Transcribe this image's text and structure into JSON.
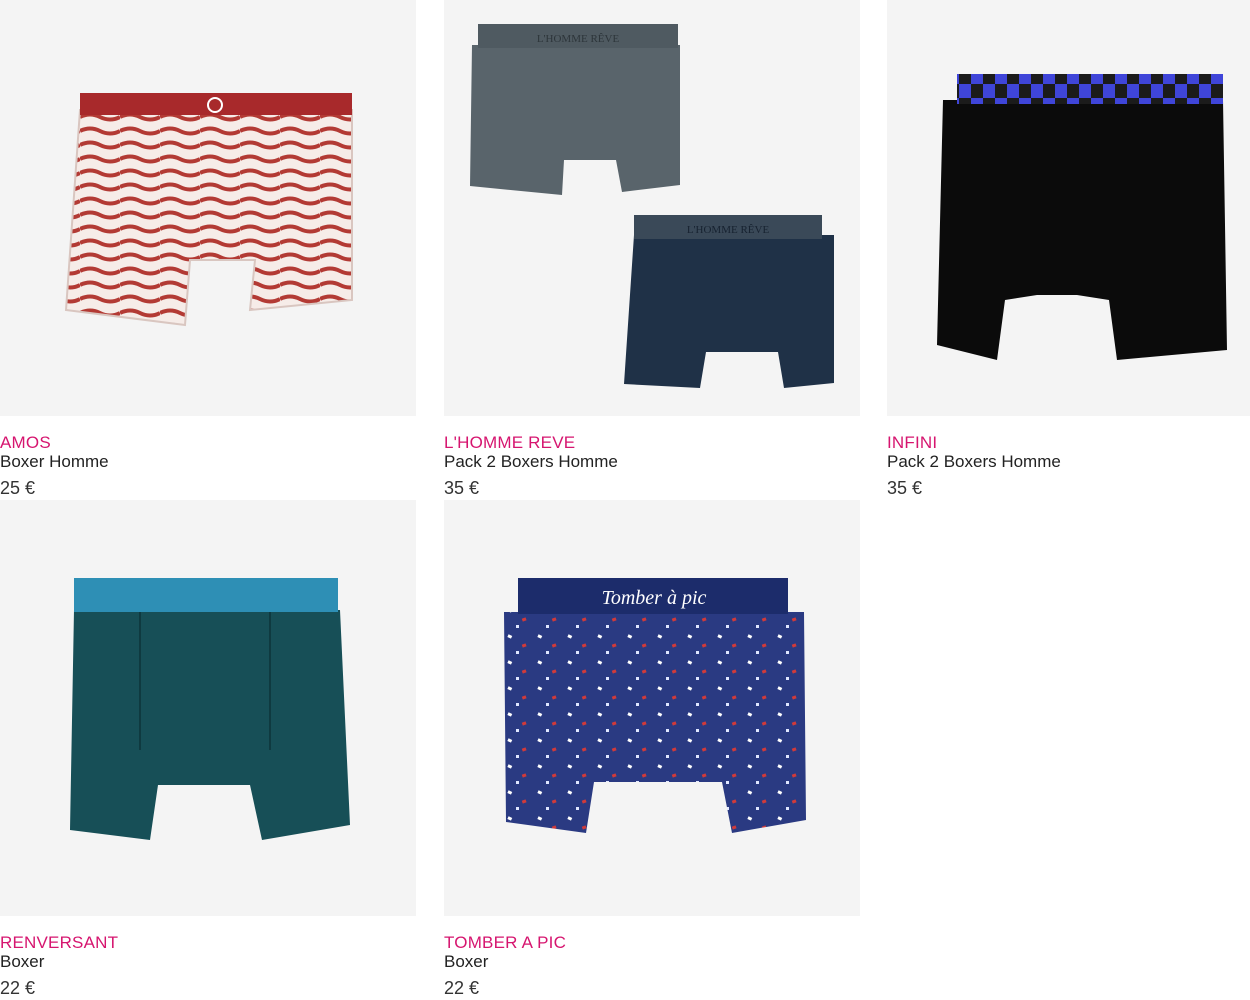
{
  "products": [
    {
      "brand": "AMOS",
      "name": "Boxer Homme",
      "price": "25 €",
      "image": "red-white-wave-boxer"
    },
    {
      "brand": "L'HOMME REVE",
      "name": "Pack 2 Boxers Homme",
      "price": "35 €",
      "image": "grey-navy-boxer-pack",
      "waistband_text": "L'HOMME RÊVE"
    },
    {
      "brand": "INFINI",
      "name": "Pack 2 Boxers Homme",
      "price": "35 €",
      "image": "black-boxer-blue-check-waistband"
    },
    {
      "brand": "RENVERSANT",
      "name": "Boxer",
      "price": "22 €",
      "image": "teal-pattern-boxer"
    },
    {
      "brand": "TOMBER A PIC",
      "name": "Boxer",
      "price": "22 €",
      "image": "navy-confetti-boxer",
      "waistband_text": "Tomber à pic"
    }
  ],
  "colors": {
    "brand_accent": "#d6156f",
    "image_bg": "#f4f4f4"
  }
}
